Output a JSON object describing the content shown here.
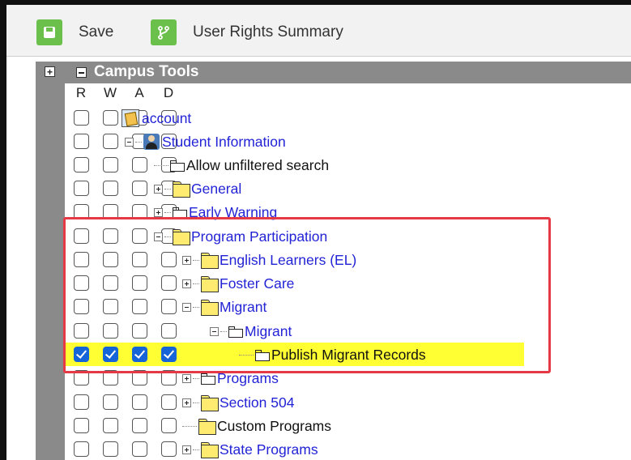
{
  "toolbar": {
    "save_label": "Save",
    "rights_label": "User Rights Summary",
    "accent": "#6bc04b"
  },
  "tree_header": {
    "title": "Campus Tools"
  },
  "columns": [
    "R",
    "W",
    "A",
    "D"
  ],
  "rows": [
    {
      "label": "account",
      "style": "link",
      "icon": "app-icon",
      "checked": [
        false,
        false,
        false,
        false
      ]
    },
    {
      "label": "Student Information",
      "style": "link",
      "icon": "person-icon",
      "checked": [
        false,
        false,
        false,
        false
      ]
    },
    {
      "label": "Allow unfiltered search",
      "style": "plain",
      "icon": "doc-icon",
      "checked": [
        false,
        false,
        false,
        false
      ]
    },
    {
      "label": "General",
      "style": "link",
      "icon": "folder-icon",
      "checked": [
        false,
        false,
        false,
        false
      ]
    },
    {
      "label": "Early Warning",
      "style": "link",
      "icon": "doc-icon",
      "checked": [
        false,
        false,
        false,
        false
      ]
    },
    {
      "label": "Program Participation",
      "style": "link",
      "icon": "folder-icon",
      "checked": [
        false,
        false,
        false,
        false
      ]
    },
    {
      "label": "English Learners (EL)",
      "style": "link",
      "icon": "folder-icon",
      "checked": [
        false,
        false,
        false,
        false
      ]
    },
    {
      "label": "Foster Care",
      "style": "link",
      "icon": "folder-icon",
      "checked": [
        false,
        false,
        false,
        false
      ]
    },
    {
      "label": "Migrant",
      "style": "link",
      "icon": "folder-icon",
      "checked": [
        false,
        false,
        false,
        false
      ]
    },
    {
      "label": "Migrant",
      "style": "link",
      "icon": "doc-icon",
      "checked": [
        false,
        false,
        false,
        false
      ]
    },
    {
      "label": "Publish Migrant Records",
      "style": "plain",
      "icon": "doc-icon",
      "checked": [
        true,
        true,
        true,
        true
      ]
    },
    {
      "label": "Programs",
      "style": "link",
      "icon": "doc-icon",
      "checked": [
        false,
        false,
        false,
        false
      ]
    },
    {
      "label": "Section 504",
      "style": "link",
      "icon": "folder-icon",
      "checked": [
        false,
        false,
        false,
        false
      ]
    },
    {
      "label": "Custom Programs",
      "style": "plain",
      "icon": "folder-icon",
      "checked": [
        false,
        false,
        false,
        false
      ]
    },
    {
      "label": "State Programs",
      "style": "link",
      "icon": "folder-icon",
      "checked": [
        false,
        false,
        false,
        false
      ]
    }
  ],
  "colors": {
    "highlight": "#ffff33",
    "callout": "#e63946",
    "checkbox_on": "#1565d8",
    "header_bg": "#8a8a8a"
  }
}
